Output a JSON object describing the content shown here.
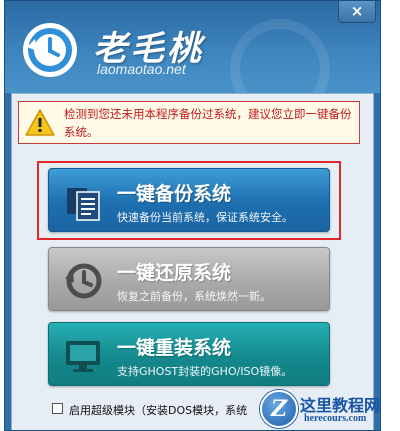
{
  "window": {
    "brand_name": "老毛桃",
    "brand_url": "laomaotao.net",
    "close_label": "×"
  },
  "warning": {
    "icon": "warning-icon",
    "text": "检测到您还未用本程序备份过系统，建议您立即一键备份系统。"
  },
  "buttons": [
    {
      "title": "一键备份系统",
      "subtitle": "快速备份当前系统，保证系统安全。",
      "icon": "document-copy-icon"
    },
    {
      "title": "一键还原系统",
      "subtitle": "恢复之前备份，系统焕然一新。",
      "icon": "clock-restore-icon"
    },
    {
      "title": "一键重装系统",
      "subtitle": "支持GHOST封装的GHO/ISO镜像。",
      "icon": "monitor-icon"
    }
  ],
  "options": {
    "advanced_label": "启用超级模块（安装DOS模块，系统",
    "advanced_checked": false
  },
  "site_watermark": {
    "title": "这里教程网",
    "url": "herecours.com",
    "badge_letter": "Z"
  }
}
